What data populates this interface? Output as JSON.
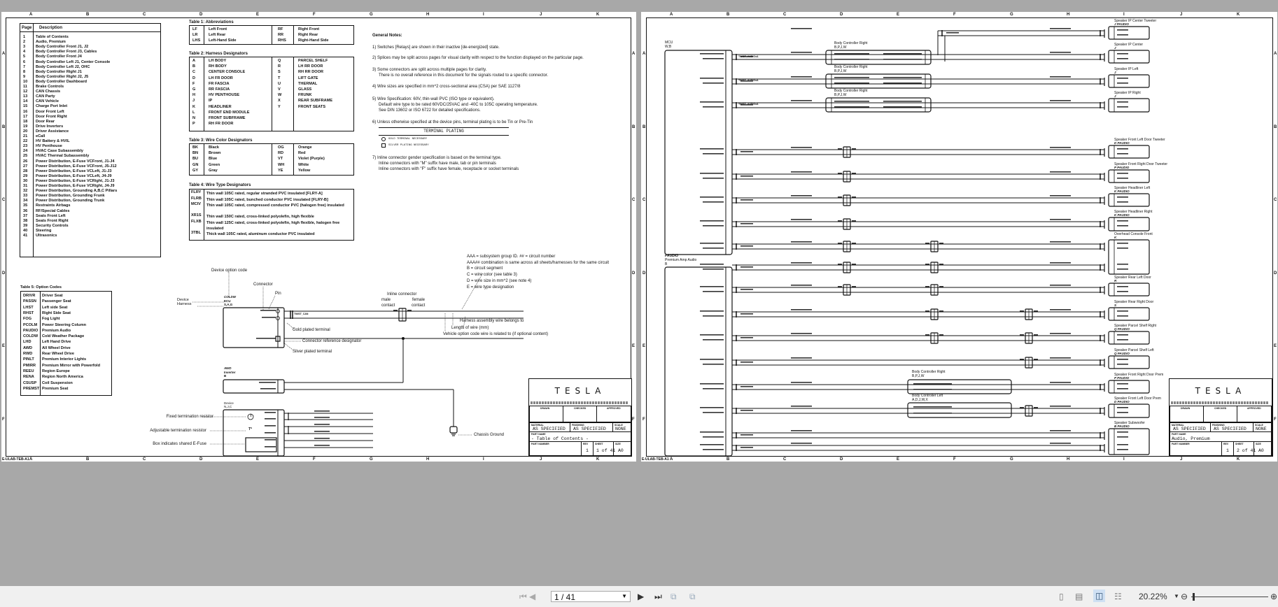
{
  "zones_top": [
    "A",
    "B",
    "C",
    "D",
    "E",
    "F",
    "G",
    "H",
    "I",
    "J",
    "K"
  ],
  "zones_side": [
    "A",
    "B",
    "C",
    "D",
    "E",
    "F"
  ],
  "page_footer": "E-ULAB-TEB-A1",
  "toc": {
    "headers": [
      "Page",
      "Description"
    ],
    "rows": [
      [
        "1",
        "Table of Contents"
      ],
      [
        "2",
        "Audio, Premium"
      ],
      [
        "3",
        "Body Controller Front J1, J2"
      ],
      [
        "4",
        "Body Controller Front J3, Cables"
      ],
      [
        "5",
        "Body Controller Front J4"
      ],
      [
        "6",
        "Body Controller Left J1, Center Console"
      ],
      [
        "7",
        "Body Controller Left J2, OHC"
      ],
      [
        "8",
        "Body Controller Right J1"
      ],
      [
        "9",
        "Body Controller Right J2, J5"
      ],
      [
        "10",
        "Body Controller Dashboard"
      ],
      [
        "11",
        "Brake Controls"
      ],
      [
        "12",
        "CAN Chassis"
      ],
      [
        "13",
        "CAN Party"
      ],
      [
        "14",
        "CAN Vehicle"
      ],
      [
        "15",
        "Charge Port Inlet"
      ],
      [
        "16",
        "Door Front Left"
      ],
      [
        "17",
        "Door Front Right"
      ],
      [
        "18",
        "Door Rear"
      ],
      [
        "19",
        "Drive Inverters"
      ],
      [
        "20",
        "Driver Assistance"
      ],
      [
        "21",
        "eCall"
      ],
      [
        "22",
        "HV Battery & HVIL"
      ],
      [
        "23",
        "HV Penthouse"
      ],
      [
        "24",
        "HVAC Case Subassembly"
      ],
      [
        "25",
        "HVAC Thermal Subassembly"
      ],
      [
        "26",
        "Power Distribution, E-Fuse VCFront, J1-J4"
      ],
      [
        "27",
        "Power Distribution, E-Fuse VCFront, J5-J12"
      ],
      [
        "28",
        "Power Distribution, E-Fuse VCLeft, J1-J3"
      ],
      [
        "29",
        "Power Distribution, E-Fuse VCLeft, J4-J9"
      ],
      [
        "30",
        "Power Distribution, E-Fuse VCRight, J1-J3"
      ],
      [
        "31",
        "Power Distribution, E-Fuse VCRight, J4-J9"
      ],
      [
        "32",
        "Power Distribution, Grounding A,B,C Pillars"
      ],
      [
        "33",
        "Power Distribution, Grounding Frunk"
      ],
      [
        "34",
        "Power Distribution, Grounding Trunk"
      ],
      [
        "35",
        "Restraints Airbags"
      ],
      [
        "36",
        "RF/Special Cables"
      ],
      [
        "37",
        "Seats Front Left"
      ],
      [
        "38",
        "Seats Front Right"
      ],
      [
        "39",
        "Security Controls"
      ],
      [
        "40",
        "Steering"
      ],
      [
        "41",
        "Ultrasonics"
      ]
    ]
  },
  "table1": {
    "title": "Table 1: Abbreviations",
    "rows": [
      [
        "LF",
        "Left Front",
        "RF",
        "Right Front"
      ],
      [
        "LR",
        "Left Rear",
        "RR",
        "Right Rear"
      ],
      [
        "LHS",
        "Left-Hand Side",
        "RHS",
        "Right-Hand Side"
      ]
    ]
  },
  "table2": {
    "title": "Table 2: Harness Designators",
    "rows": [
      [
        "A",
        "LH BODY",
        "Q",
        "PARCEL SHELF"
      ],
      [
        "B",
        "RH BODY",
        "R",
        "LH RR DOOR"
      ],
      [
        "C",
        "CENTER CONSOLE",
        "S",
        "RH RR DOOR"
      ],
      [
        "D",
        "LH FR DOOR",
        "T",
        "LIFT GATE"
      ],
      [
        "F",
        "FR FASCIA",
        "U",
        "THERMAL"
      ],
      [
        "G",
        "RR FASCIA",
        "V",
        "GLASS"
      ],
      [
        "H",
        "HV PENTHOUSE",
        "W",
        "FRUNK"
      ],
      [
        "J",
        "IP",
        "X",
        "REAR SUBFRAME"
      ],
      [
        "K",
        "HEADLINER",
        "Y",
        "FRONT SEATS"
      ],
      [
        "L",
        "FRONT END MODULE",
        "",
        ""
      ],
      [
        "N",
        "FRONT SUBFRAME",
        "",
        ""
      ],
      [
        "P",
        "RH FR DOOR",
        "",
        ""
      ]
    ]
  },
  "table3": {
    "title": "Table 3: Wire Color Designators",
    "rows": [
      [
        "BK",
        "Black",
        "OG",
        "Orange"
      ],
      [
        "BN",
        "Brown",
        "RD",
        "Red"
      ],
      [
        "BU",
        "Blue",
        "VT",
        "Violet (Purple)"
      ],
      [
        "GN",
        "Green",
        "WH",
        "White"
      ],
      [
        "GY",
        "Gray",
        "YE",
        "Yellow"
      ]
    ]
  },
  "table4": {
    "title": "Table 4: Wire Type Designators",
    "rows": [
      [
        "FLRY",
        "Thin wall 105C rated, regular stranded PVC insulated [FLRY-A]"
      ],
      [
        "FLRB",
        "Thin wall 105C rated, bunched conductor PVC insulated [FLRY-B]"
      ],
      [
        "MCIV",
        "Thin wall 105C rated, compressed conductor PVC (halogen free) insulated"
      ],
      [
        "XR1S",
        "Thin wall 150C rated, cross-linked polyolefin, high flexible"
      ],
      [
        "FLXB",
        "Thin wall 125C rated, cross-linked polyolefin, high flexible, halogen free insulated"
      ],
      [
        "3TBL",
        "Thick wall 105C rated, aluminum conductor PVC insulated"
      ]
    ]
  },
  "table5": {
    "title": "Table 5: Option Codes",
    "rows": [
      [
        "DRIVR",
        "Driver Seat"
      ],
      [
        "PASSN",
        "Passenger Seat"
      ],
      [
        "LHST",
        "Left side Seat"
      ],
      [
        "RHST",
        "Right Side Seat"
      ],
      [
        "FOG",
        "Fog Light"
      ],
      [
        "PCOLM",
        "Power Steering Column"
      ],
      [
        "PAUDIO",
        "Premium Audio"
      ],
      [
        "COLDW",
        "Cold Weather Package"
      ],
      [
        "LHD",
        "Left Hand Drive"
      ],
      [
        "AWD",
        "All Wheel Drive"
      ],
      [
        "RWD",
        "Rear Wheel Drive"
      ],
      [
        "PINLT",
        "Premium Interior Lights"
      ],
      [
        "PMIRR",
        "Premium Mirror with Powerfold"
      ],
      [
        "REEU",
        "Region Europe"
      ],
      [
        "RENA",
        "Region North America"
      ],
      [
        "CSUSP",
        "Coil Suspension"
      ],
      [
        "PREMST",
        "Premium Seat"
      ]
    ]
  },
  "notes": {
    "title": "General Notes:",
    "n1": "1) Switches [Relays] are shown in their inactive [de-energized] state.",
    "n2": "2) Splices may be split across pages for visual clarity with respect to the function displayed on the particular page.",
    "n3a": "3) Some connectors are split across multiple pages for clarity.",
    "n3b": "There is no overall reference in this document for the signals routed to a specific connector.",
    "n4": "4) Wire sizes are specified in mm^2 cross-sectional area (CSA) per SAE 1127/8",
    "n5a": "5) Wire Specification: 60V, thin-wall PVC (ISO type or equivalent).",
    "n5b": "Default wire type to be rated 60VDC/25VAC and -40C to 105C operating temperature.",
    "n5c": "See DIN 13602 or ISO 6722 for detailed specifications.",
    "n6": "6) Unless otherwise specified at the device pins, terminal plating is to be Tin or Pre-Tin",
    "plating_header": "TERMINAL PLATING",
    "plating_gold": "GOLD TERMINAL NECESSARY",
    "plating_silver": "SILVER PLATING NECESSARY",
    "n7a": "7) Inline connector gender specification is based on the terminal type.",
    "n7b": "Inline connectors with \"M\" suffix have male, tab or pin terminals",
    "n7c": "Inline connectors with \"F\" suffix have female, receptacle or socket terminals"
  },
  "legend": {
    "device_option_code": "Device option code",
    "connector": "Connector",
    "pin": "Pin",
    "option": "COLDW",
    "device_name": "ECU",
    "harness_codes": "S,A,G",
    "device": "Device",
    "harness": "Harness",
    "twist": "TWIST_CAN",
    "inline_connector": "Inline connector",
    "male": "male",
    "female": "female",
    "contact": "contact",
    "gold": "Gold plated terminal",
    "ref_designator": "Connector reference designator",
    "silver": "Silver plated terminal",
    "awd": "AWD",
    "inverter": "Inverter",
    "awd_harness": "B",
    "device2": "Device",
    "device2_harness": "N,J,C",
    "fixed_res": "Fixed termination resistor",
    "adj_res": "Adjustable termination resistor",
    "efuse": "Box indicates shared E-Fuse",
    "res_symbol": "T",
    "adj_symbol": "T*",
    "chassis_ground": "Chassis Ground",
    "aaa1": "AAA = subsystem group ID. ## = circuit number",
    "aaa2": "AAA## combination is same across all sheets/harnesses for the same circuit",
    "aaa3": "B = circuit segment",
    "aaa4": "C = wire color (see table 3)",
    "aaa5": "D = wire size in mm^2 (see note 4)",
    "aaa6": "E = wire type designation",
    "harness_belongs": "Harness assembly wire belongs to",
    "length": "Length of wire (mm)",
    "vehicle_option": "Vehicle option code wire is related to (if optional content)"
  },
  "titleblock_left": {
    "logo": "TESLA",
    "drawn": "DRAWN",
    "checked": "CHECKED",
    "approved": "APPROVED",
    "material_lbl": "MATERIAL",
    "material": "AS SPECIFIED",
    "finishing_lbl": "FINISHING",
    "finishing": "AS SPECIFIED",
    "scale_lbl": "SCALE",
    "scale": "NONE",
    "partname_lbl": "PART NAME",
    "partname": "- Table of Contents -",
    "partnumber_lbl": "PART NUMBER",
    "rev_lbl": "REV",
    "rev": "1",
    "sheet_lbl": "SHEET",
    "sheet": "1 of 41",
    "size_lbl": "SIZE",
    "size": "A0"
  },
  "titleblock_right": {
    "logo": "TESLA",
    "drawn": "DRAWN",
    "checked": "CHECKED",
    "approved": "APPROVED",
    "material_lbl": "MATERIAL",
    "material": "AS SPECIFIED",
    "finishing_lbl": "FINISHING",
    "finishing": "AS SPECIFIED",
    "scale_lbl": "SCALE",
    "scale": "NONE",
    "partname_lbl": "PART NAME",
    "partname": "Audio, Premium",
    "partnumber_lbl": "PART NUMBER",
    "rev_lbl": "REV",
    "rev": "1",
    "sheet_lbl": "SHEET",
    "sheet": "2 of 41",
    "size_lbl": "SIZE",
    "size": "A0"
  },
  "schematic": {
    "mcu": {
      "name": "MCU",
      "harness": "W,B"
    },
    "paudio": {
      "option": "PAUDIO",
      "name": "Premium Amp Audio",
      "harness": "B"
    },
    "bcr": {
      "name": "Body Controller Right",
      "harness": "B,P,J,W"
    },
    "bcr2": {
      "name": "Body Controller Right",
      "harness": "B,P,J,W"
    },
    "bcl": {
      "name": "Body Controller Left",
      "harness": "A,D,J,W,X"
    },
    "twist_label": "TWIST_AUDIOxA",
    "speakers": [
      {
        "name": "Speaker IP Center Tweeter",
        "harness": "J PAUDIO"
      },
      {
        "name": "Speaker IP Center",
        "harness": "J"
      },
      {
        "name": "Speaker IP Left",
        "harness": "J"
      },
      {
        "name": "Speaker IP Right",
        "harness": "J"
      },
      {
        "name": "Speaker Front Left Door Tweeter",
        "harness": "D PAUDIO"
      },
      {
        "name": "Speaker Front Right Door Tweeter",
        "harness": "P PAUDIO"
      },
      {
        "name": "Speaker Headliner Left",
        "harness": "K PAUDIO"
      },
      {
        "name": "Speaker Headliner Right",
        "harness": "K PAUDIO"
      },
      {
        "name": "Overhead Console Front",
        "harness": "K"
      },
      {
        "name": "Speaker Rear Left Door",
        "harness": "R"
      },
      {
        "name": "Speaker Rear Right Door",
        "harness": "S"
      },
      {
        "name": "Speaker Parcel Shelf Right",
        "harness": "Q PAUDIO"
      },
      {
        "name": "Speaker Parcel Shelf Left",
        "harness": "Q PAUDIO"
      },
      {
        "name": "Speaker Front Right Door Prem",
        "harness": "P PAUDIO"
      },
      {
        "name": "Speaker Front Left Door Prem",
        "harness": "D PAUDIO"
      },
      {
        "name": "Speaker Subwoofer",
        "harness": "B PAUDIO"
      }
    ]
  },
  "toolbar": {
    "page_value": "1 / 41",
    "zoom": "20.22%"
  }
}
